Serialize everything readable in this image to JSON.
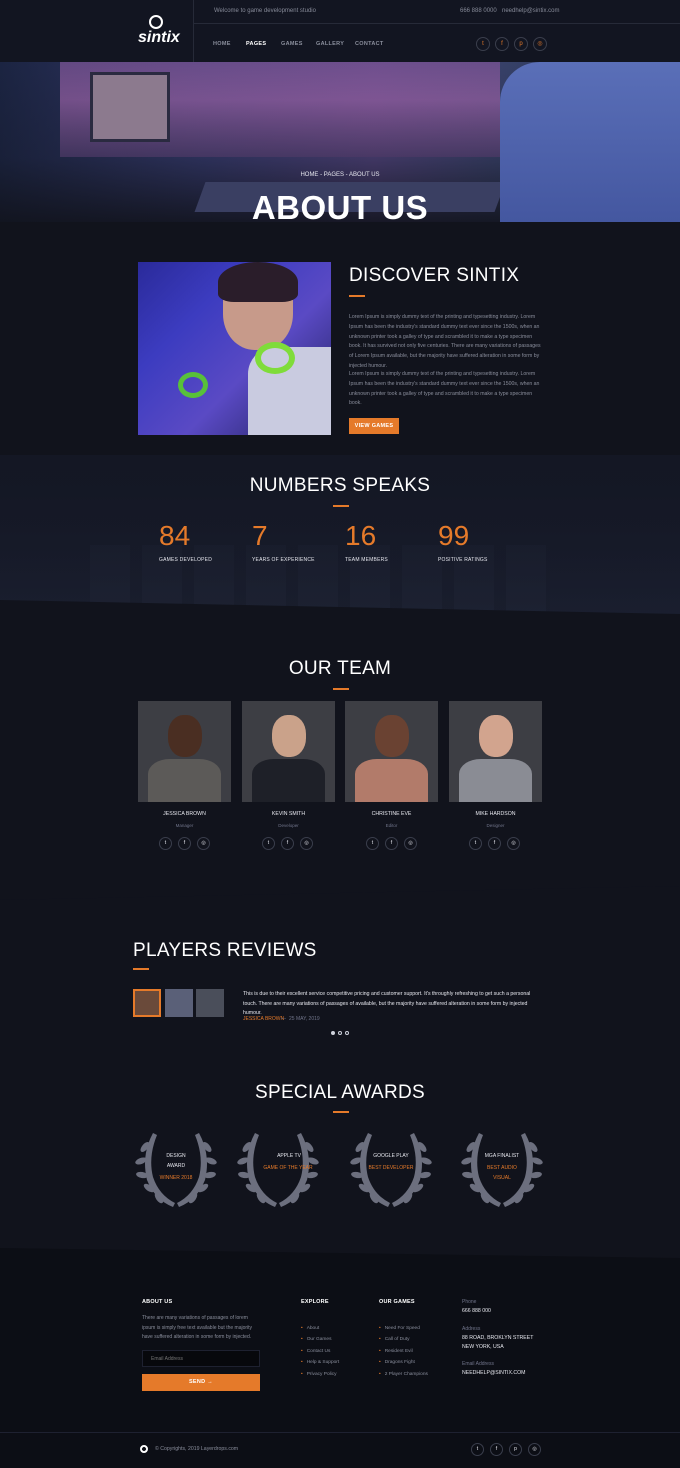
{
  "header": {
    "brand": "sintix",
    "welcome": "Welcome to game development studio",
    "phone": "666 888 0000",
    "email": "needhelp@sintix.com",
    "nav": [
      "HOME",
      "PAGES",
      "GAMES",
      "GALLERY",
      "CONTACT"
    ],
    "active_nav": "PAGES",
    "social_icons": [
      "twitter-icon",
      "facebook-icon",
      "pinterest-icon",
      "instagram-icon"
    ]
  },
  "hero": {
    "breadcrumb": "HOME - PAGES - ABOUT US",
    "title": "ABOUT US"
  },
  "discover": {
    "title": "DISCOVER SINTIX",
    "paragraph1": "Lorem Ipsum is simply dummy text of the printing and typesetting industry. Lorem Ipsum has been the industry's standard dummy text ever since the 1500s, when an unknown printer took a galley of type and scrambled it to make a type specimen book. It has survived not only five centuries. There are many variations of passages of Lorem Ipsum available, but the majority have suffered alteration in some form by injected humour.",
    "paragraph2": "Lorem Ipsum is simply dummy text of the printing and typesetting industry. Lorem Ipsum has been the industry's standard dummy text ever since the 1500s, when an unknown printer took a galley of type and scrambled it to make a type specimen book.",
    "button": "VIEW GAMES"
  },
  "numbers": {
    "title": "NUMBERS SPEAKS",
    "items": [
      {
        "value": "84",
        "label": "GAMES DEVELOPED"
      },
      {
        "value": "7",
        "label": "YEARS OF EXPERIENCE"
      },
      {
        "value": "16",
        "label": "TEAM MEMBERS"
      },
      {
        "value": "99",
        "label": "POSITIVE RATINGS"
      }
    ]
  },
  "team": {
    "title": "OUR TEAM",
    "members": [
      {
        "name": "JESSICA BROWN",
        "role": "Manager"
      },
      {
        "name": "KEVIN SMITH",
        "role": "Developer"
      },
      {
        "name": "CHRISTINE EVE",
        "role": "Editor"
      },
      {
        "name": "MIKE HARDSON",
        "role": "Designer"
      }
    ]
  },
  "reviews": {
    "title": "PLAYERS REVIEWS",
    "quote": "This is due to their excellent service competitive pricing and customer support. It's throughly refreshing to get such a personal touch. There are many variations of passages of available, but the majority have suffered alteration in some form by injected humour.",
    "author": "JESSICA BROWN",
    "date": "25 MAY, 2019"
  },
  "awards": {
    "title": "SPECIAL AWARDS",
    "items": [
      {
        "line1": "DESIGN",
        "line2": "AWARD",
        "highlight": "WINNER 2018"
      },
      {
        "line1": "APPLE TV",
        "line2": "",
        "highlight": "GAME OF THE YEAR"
      },
      {
        "line1": "GOOGLE PLAY",
        "line2": "",
        "highlight": "BEST DEVELOPER"
      },
      {
        "line1": "MGA FINALIST",
        "line2": "",
        "highlight": "BEST AUDIO VISUAL"
      }
    ]
  },
  "footer": {
    "about_title": "ABOUT US",
    "about_text": "There are many variations of passages of lorem ipsum is simply free text available but the majority have suffered alteration in some form by injected.",
    "email_placeholder": "Email Address",
    "send": "SEND",
    "explore_title": "EXPLORE",
    "explore": [
      "About",
      "Our Games",
      "Contact Us",
      "Help & Support",
      "Privacy Policy"
    ],
    "games_title": "OUR GAMES",
    "games": [
      "Need For Speed",
      "Call of Duty",
      "Resident Evil",
      "Dragons Fight",
      "2 Player Champions"
    ],
    "phone_label": "Phone",
    "phone": "666 888 000",
    "address_label": "Address",
    "address": "88 ROAD, BROKLYN STREET NEW YORK, USA",
    "email_label": "Email Address",
    "email": "NEEDHELP@SINTIX.COM",
    "copyright": "© Copyrights, 2019 Layerdrops.com"
  },
  "colors": {
    "accent": "#e57a2a",
    "background": "#11131c"
  }
}
